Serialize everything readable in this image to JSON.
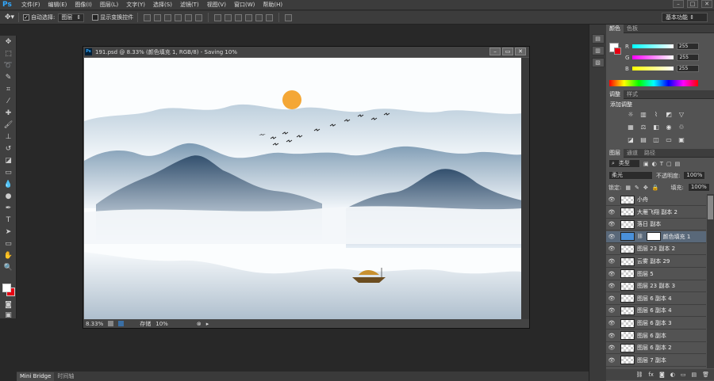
{
  "app": {
    "logo": "Ps"
  },
  "menu": [
    "文件(F)",
    "编辑(E)",
    "图像(I)",
    "图层(L)",
    "文字(Y)",
    "选择(S)",
    "滤镜(T)",
    "视图(V)",
    "窗口(W)",
    "帮助(H)"
  ],
  "options_bar": {
    "auto_select_label": "自动选择:",
    "auto_select_value": "图层",
    "show_transform_label": "显示变换控件",
    "workspace": "基本功能"
  },
  "document": {
    "title": "191.psd @ 8.33% (颜色填充 1, RGB/8) - Saving 10%",
    "zoom": "8.33%",
    "save_label": "存储",
    "save_progress": "10%"
  },
  "color_panel": {
    "tabs": [
      "颜色",
      "色板"
    ],
    "r_label": "R",
    "g_label": "G",
    "b_label": "B",
    "r_value": "255",
    "g_value": "255",
    "b_value": "255"
  },
  "adjust_panel": {
    "tabs": [
      "调整",
      "样式"
    ],
    "title": "添加调整"
  },
  "layers_panel": {
    "tabs": [
      "图层",
      "通道",
      "路径"
    ],
    "filter_type": "类型",
    "blend_mode": "柔光",
    "opacity_label": "不透明度:",
    "opacity_value": "100%",
    "lock_label": "锁定:",
    "fill_label": "填充:",
    "fill_value": "100%",
    "layers": [
      "小舟",
      "大雁飞翔 副本 2",
      "落日 副本",
      "颜色填充 1",
      "图层 23 副本 2",
      "云雾 副本 29",
      "图层 5",
      "图层 23 副本 3",
      "图层 6 副本 4",
      "图层 6 副本 4",
      "图层 6 副本 3",
      "图层 6 副本",
      "图层 6 副本 2",
      "图层 7 副本"
    ],
    "selected_index": 3
  },
  "bottom_tabs": [
    "Mini Bridge",
    "时间轴"
  ],
  "colors": {
    "foreground": "#ffffff",
    "background": "#e60012",
    "sun": "#f4a736",
    "selected_layer": "#596879"
  }
}
